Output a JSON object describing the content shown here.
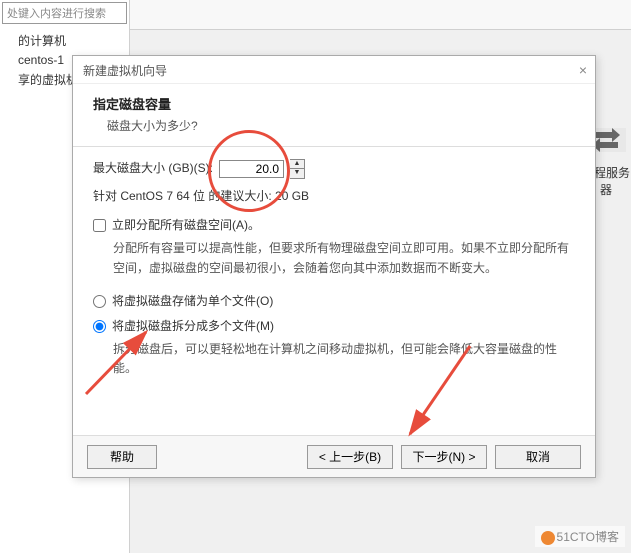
{
  "left_panel": {
    "search_placeholder": "处键入内容进行搜索",
    "tree": {
      "item1": "的计算机",
      "item2": "centos-1",
      "item3": "享的虚拟机"
    }
  },
  "right_side": {
    "label": "远程服务器"
  },
  "dialog": {
    "title": "新建虚拟机向导",
    "header_title": "指定磁盘容量",
    "header_sub": "磁盘大小为多少?",
    "disk_size_label": "最大磁盘大小 (GB)(S):",
    "disk_size_value": "20.0",
    "recommend_label": "针对 CentOS 7 64 位 的建议大小: 20 GB",
    "allocate_now_label": "立即分配所有磁盘空间(A)。",
    "allocate_desc": "分配所有容量可以提高性能，但要求所有物理磁盘空间立即可用。如果不立即分配所有空间，虚拟磁盘的空间最初很小，会随着您向其中添加数据而不断变大。",
    "radio_single_label": "将虚拟磁盘存储为单个文件(O)",
    "radio_multi_label": "将虚拟磁盘拆分成多个文件(M)",
    "radio_multi_desc": "拆分磁盘后，可以更轻松地在计算机之间移动虚拟机，但可能会降低大容量磁盘的性能。",
    "btn_help": "帮助",
    "btn_back": "< 上一步(B)",
    "btn_next": "下一步(N) >",
    "btn_cancel": "取消"
  },
  "watermark": "51CTO博客"
}
